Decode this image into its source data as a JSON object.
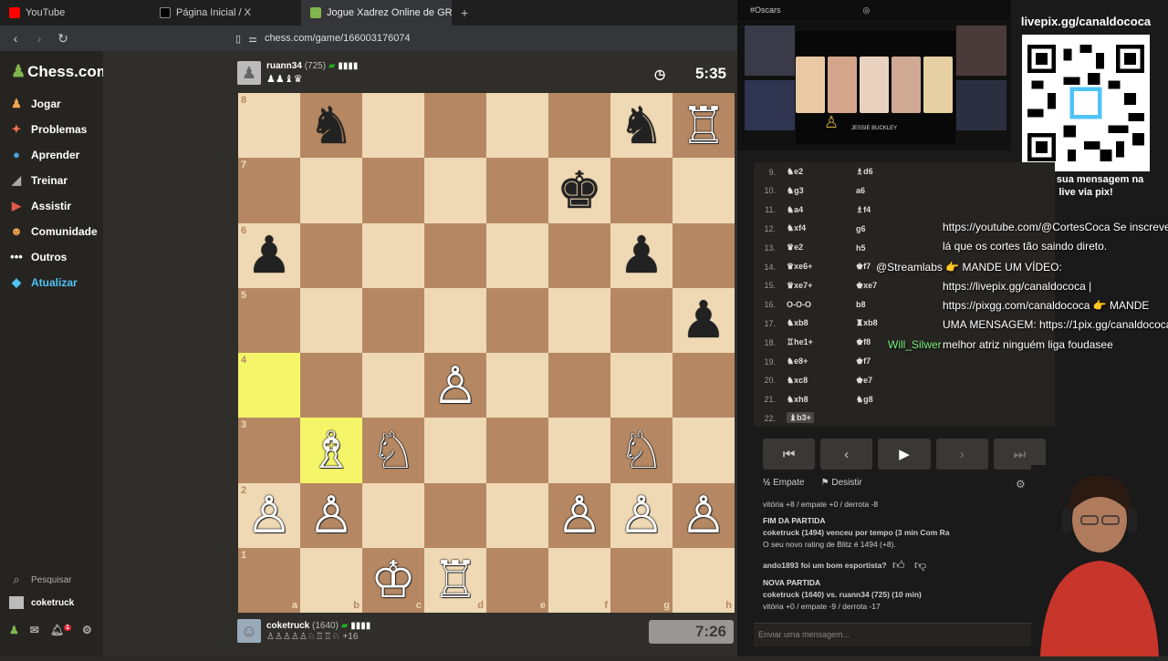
{
  "browser": {
    "tabs": [
      {
        "label": "YouTube",
        "color": "#ff0000"
      },
      {
        "label": "Página Inicial / X",
        "color": "#000000"
      },
      {
        "label": "Jogue Xadrez Online de GRAÇ",
        "color": "#81b64c"
      }
    ],
    "new_tab": "+",
    "url": "chess.com/game/166003176074"
  },
  "sidebar": {
    "logo": "Chess.com",
    "items": [
      {
        "label": "Jogar",
        "icon": "play-icon"
      },
      {
        "label": "Problemas",
        "icon": "puzzle-icon"
      },
      {
        "label": "Aprender",
        "icon": "learn-icon"
      },
      {
        "label": "Treinar",
        "icon": "train-icon"
      },
      {
        "label": "Assistir",
        "icon": "watch-icon"
      },
      {
        "label": "Comunidade",
        "icon": "community-icon"
      },
      {
        "label": "Outros",
        "icon": "more-icon"
      },
      {
        "label": "Atualizar",
        "icon": "diamond-icon"
      }
    ],
    "search": "Pesquisar",
    "user": "coketruck",
    "notification_count": "1"
  },
  "top_player": {
    "name": "ruann34",
    "rating": "(725)",
    "captured": "♟♟♝♛",
    "clock": "5:35"
  },
  "bottom_player": {
    "name": "coketruck",
    "rating": "(1640)",
    "captured": "♙♙♙♙♙♘♖♖♘",
    "advantage": "+16",
    "clock": "7:26"
  },
  "board": {
    "ranks": [
      "8",
      "7",
      "6",
      "5",
      "4",
      "3",
      "2",
      "1"
    ],
    "files": [
      "a",
      "b",
      "c",
      "d",
      "e",
      "f",
      "g",
      "h"
    ],
    "pieces": {
      "b8": "♞",
      "g8": "♞",
      "h8": "♖",
      "f7": "♚",
      "a6": "♟",
      "g6": "♟",
      "h5": "♟",
      "d4": "♙",
      "b3": "♗",
      "c3": "♘",
      "g3": "♘",
      "a2": "♙",
      "b2": "♙",
      "f2": "♙",
      "g2": "♙",
      "h2": "♙",
      "c1": "♔",
      "d1": "♖"
    },
    "white_squares": [
      "h8",
      "d4",
      "b3",
      "c3",
      "g3",
      "a2",
      "b2",
      "f2",
      "g2",
      "h2",
      "c1",
      "d1"
    ],
    "highlighted": [
      "a4",
      "b3"
    ]
  },
  "moves": [
    {
      "n": "9.",
      "w": "♞e2",
      "b": "♗d6"
    },
    {
      "n": "10.",
      "w": "♞g3",
      "b": "a6"
    },
    {
      "n": "11.",
      "w": "♞a4",
      "b": "♗f4"
    },
    {
      "n": "12.",
      "w": "♞xf4",
      "b": "g6"
    },
    {
      "n": "13.",
      "w": "♛e2",
      "b": "h5"
    },
    {
      "n": "14.",
      "w": "♛xe6+",
      "b": "♚f7"
    },
    {
      "n": "15.",
      "w": "♛xe7+",
      "b": "♚xe7"
    },
    {
      "n": "16.",
      "w": "O-O-O",
      "b": "b8"
    },
    {
      "n": "17.",
      "w": "♞xb8",
      "b": "♜xb8"
    },
    {
      "n": "18.",
      "w": "♖he1+",
      "b": "♚f8"
    },
    {
      "n": "19.",
      "w": "♞e8+",
      "b": "♚f7"
    },
    {
      "n": "20.",
      "w": "♞xc8",
      "b": "♚e7"
    },
    {
      "n": "21.",
      "w": "♞xh8",
      "b": "♞g8"
    },
    {
      "n": "22.",
      "w": "♝b3+",
      "b": ""
    }
  ],
  "chat_overlay": {
    "lines": [
      "https://youtube.com/@CortesCoca Se inscreve",
      "lá que os cortes tão saindo direto.",
      "@Streamlabs 👉 MANDE UM VÍDEO:",
      "https://livepix.gg/canaldococa |",
      "https://pixgg.com/canaldococa 👉 MANDE",
      "UMA MENSAGEM: https://1pix.gg/canaldococa"
    ],
    "user2": "Will_Silwer",
    "msg2": "melhor atriz ninguém liga foudasee"
  },
  "qr": {
    "title": "livepix.gg/canaldococa",
    "footer1": "envie sua mensagem na",
    "footer2": "live via pix!"
  },
  "oscars": {
    "tag": "#Oscars",
    "caption": "JESSIE BUCKLEY"
  },
  "actions": {
    "draw": "Empate",
    "resign": "Desistir"
  },
  "chat": {
    "l1": "vitória +8 / empate +0 / derrota -8",
    "l2": "FIM DA PARTIDA",
    "l3": "coketruck (1494) venceu por tempo (3 min Com Ra",
    "l4": "O seu novo rating de Blitz é 1494 (+8).",
    "l5": "ando1893 foi um bom esportista?",
    "l6": "NOVA PARTIDA",
    "l7": "coketruck (1640) vs. ruann34 (725) (10 min)",
    "l8": "vitória +0 / empate -9 / derrota -17",
    "placeholder": "Enviar uma mensagem..."
  }
}
